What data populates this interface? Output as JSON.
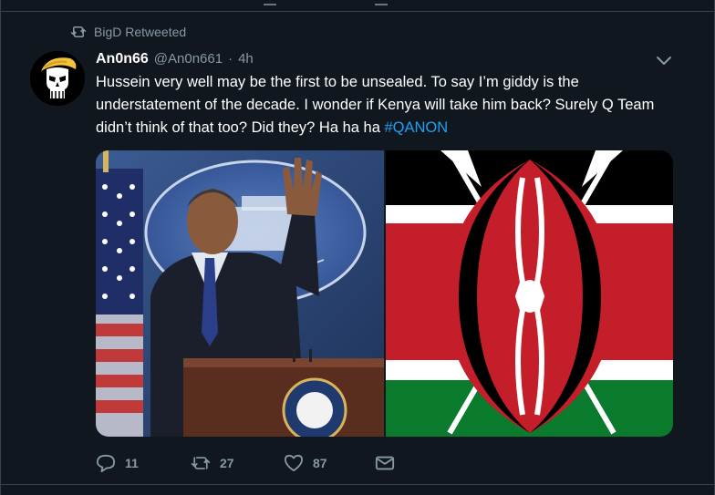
{
  "retweet": {
    "label": "BigD Retweeted",
    "icon": "retweet-icon"
  },
  "tweet": {
    "display_name": "An0n66",
    "handle": "@An0n661",
    "separator": "·",
    "time": "4h",
    "text_main": "Hussein very well may be the first to be unsealed. To say I’m giddy is the understatement of the decade. I wonder if Kenya will take him back? Surely Q Team didn’t think of that too? Did they?  Ha ha ha ",
    "hashtag": "#QANON",
    "menu_icon": "chevron-down-icon"
  },
  "media": {
    "left": {
      "icon": "photo-president-waving"
    },
    "right": {
      "icon": "kenya-flag"
    },
    "podium_seal_icon": "presidential-seal-icon"
  },
  "actions": {
    "reply": {
      "count": "11",
      "icon": "reply-icon"
    },
    "retweet": {
      "count": "27",
      "icon": "retweet-icon"
    },
    "like": {
      "count": "87",
      "icon": "heart-icon"
    },
    "dm": {
      "icon": "envelope-icon"
    }
  },
  "colors": {
    "background": "#10171e",
    "muted": "#8899a6",
    "link": "#1da1f2",
    "divider": "#38444d"
  }
}
